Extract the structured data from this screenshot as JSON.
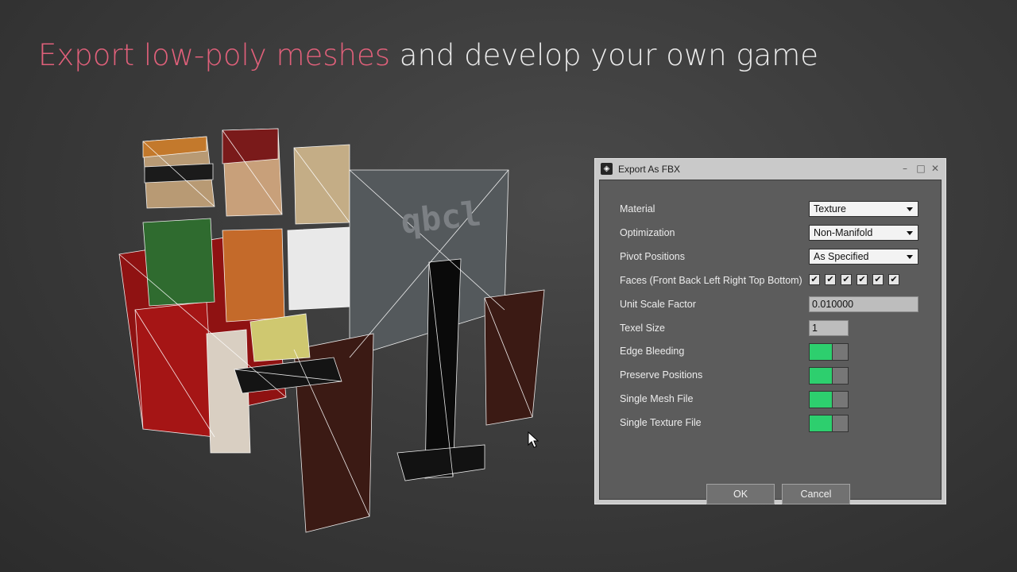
{
  "headline": {
    "accent_text": "Export low-poly meshes",
    "rest_text": " and develop your own game",
    "accent_color": "#e0607a"
  },
  "scene": {
    "monitor_text": "qbcl"
  },
  "dialog": {
    "title": "Export As FBX",
    "window_controls": [
      "minimize-icon",
      "maximize-icon",
      "close-icon"
    ],
    "fields": {
      "material": {
        "label": "Material",
        "value": "Texture"
      },
      "optimization": {
        "label": "Optimization",
        "value": "Non-Manifold"
      },
      "pivot": {
        "label": "Pivot Positions",
        "value": "As Specified"
      },
      "faces": {
        "label": "Faces (Front Back Left Right Top Bottom)",
        "checked": [
          true,
          true,
          true,
          true,
          true,
          true
        ]
      },
      "unit_scale": {
        "label": "Unit Scale Factor",
        "value": "0.010000"
      },
      "texel_size": {
        "label": "Texel Size",
        "value": "1"
      },
      "edge_bleeding": {
        "label": "Edge Bleeding",
        "on": true
      },
      "preserve_positions": {
        "label": "Preserve Positions",
        "on": true
      },
      "single_mesh": {
        "label": "Single Mesh File",
        "on": true
      },
      "single_texture": {
        "label": "Single Texture File",
        "on": true
      }
    },
    "buttons": {
      "ok": "OK",
      "cancel": "Cancel"
    },
    "toggle_on_color": "#2dcf6e"
  }
}
